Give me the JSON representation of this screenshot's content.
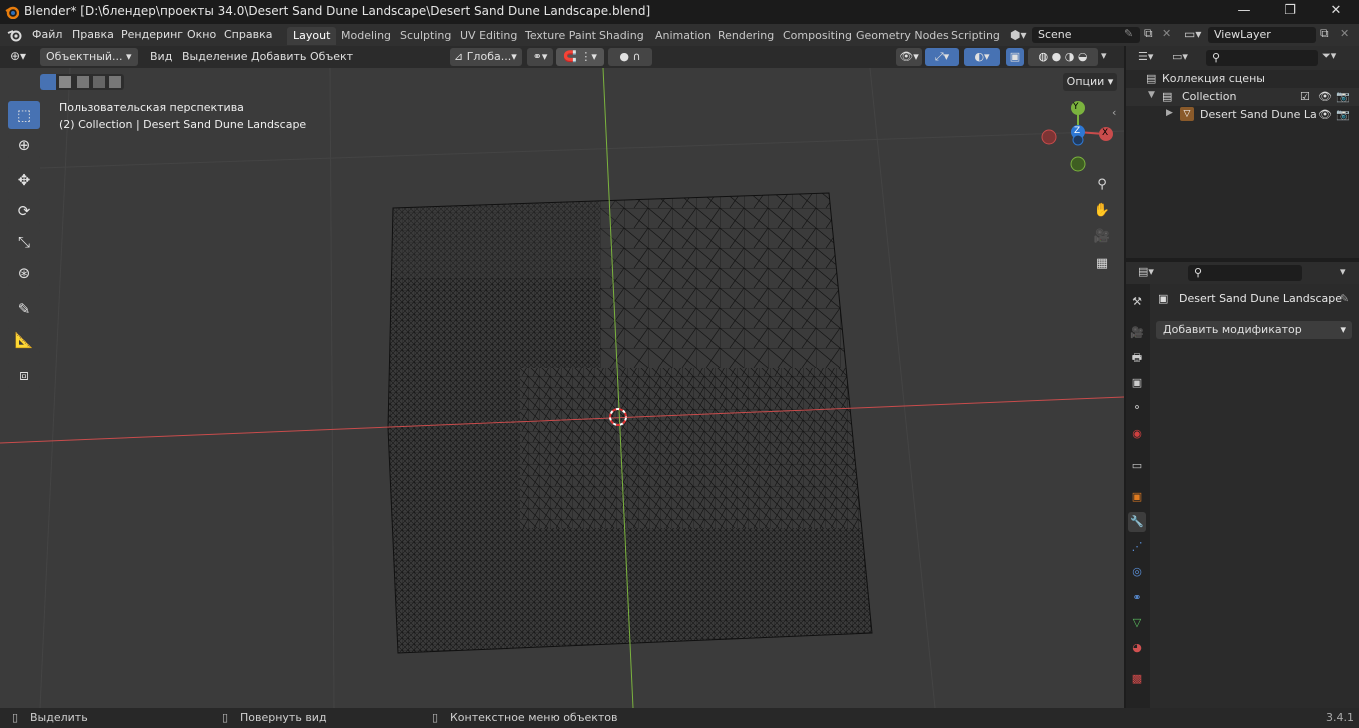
{
  "window": {
    "title": "Blender* [D:\\блендер\\проекты 34.0\\Desert Sand Dune Landscape\\Desert Sand Dune Landscape.blend]",
    "minimize": "—",
    "maximize": "❐",
    "close": "✕"
  },
  "menu": [
    "Файл",
    "Правка",
    "Рендеринг",
    "Окно",
    "Справка"
  ],
  "workspaces": [
    "Layout",
    "Modeling",
    "Sculpting",
    "UV Editing",
    "Texture Paint",
    "Shading",
    "Animation",
    "Rendering",
    "Compositing",
    "Geometry Nodes",
    "Scripting"
  ],
  "active_workspace": "Layout",
  "scene": {
    "name": "Scene"
  },
  "view_layer": {
    "name": "ViewLayer"
  },
  "viewport_header": {
    "mode": "Объектный...",
    "menus": [
      "Вид",
      "Выделение",
      "Добавить",
      "Объект"
    ],
    "orientation": "Глоба...",
    "options": "Опции"
  },
  "viewport": {
    "view_name": "Пользовательская перспектива",
    "collection_info": "(2) Collection | Desert Sand Dune Landscape"
  },
  "gizmo": {
    "y": "Y",
    "z": "Z",
    "x": "X"
  },
  "tools": [
    "select-box",
    "cursor",
    "move",
    "rotate",
    "scale",
    "transform",
    "annotate",
    "measure",
    "add-cube"
  ],
  "outliner": {
    "root": "Коллекция сцены",
    "collection": "Collection",
    "object": "Desert Sand Dune La"
  },
  "properties": {
    "object_name": "Desert Sand Dune Landscape",
    "add_modifier": "Добавить модификатор"
  },
  "status": {
    "select": "Выделить",
    "rotate": "Повернуть вид",
    "context": "Контекстное меню объектов",
    "version": "3.4.1"
  },
  "colors": {
    "accent": "#4772b3",
    "x_axis": "#c94c4c",
    "y_axis": "#7bb33e",
    "z_axis": "#2e78d4"
  }
}
